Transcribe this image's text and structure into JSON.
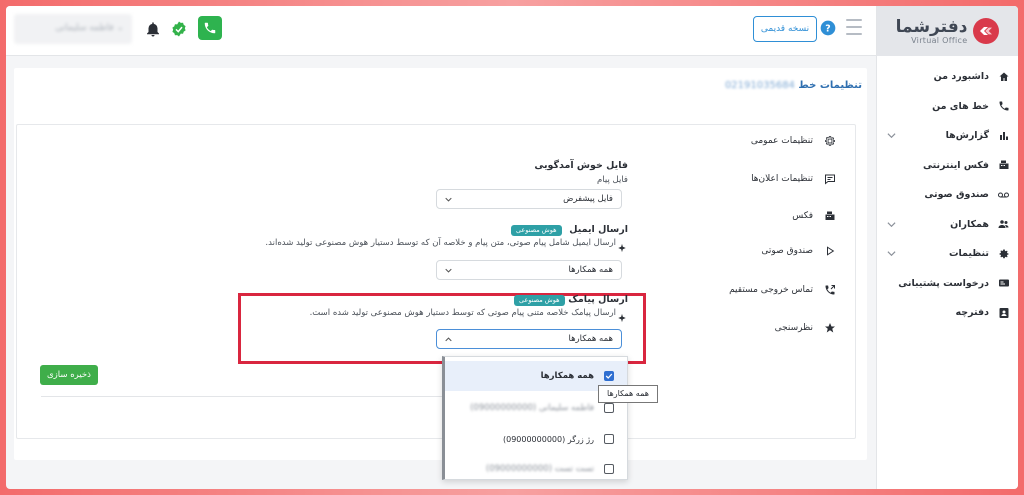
{
  "topbar": {
    "user_name": "فاطمه سلیمانی",
    "old_version_label": "نسخه قدیمی"
  },
  "logo": {
    "title": "دفترشما",
    "subtitle": "Virtual Office"
  },
  "sidebar": {
    "items": [
      {
        "label": "داشبورد من",
        "icon": "home-icon",
        "expandable": false
      },
      {
        "label": "خط های من",
        "icon": "phone-icon",
        "expandable": false
      },
      {
        "label": "گزارش‌ها",
        "icon": "chart-icon",
        "expandable": true
      },
      {
        "label": "فکس اینترنتی",
        "icon": "fax-icon",
        "expandable": false
      },
      {
        "label": "صندوق صوتی",
        "icon": "voicemail-icon",
        "expandable": false
      },
      {
        "label": "همکاران",
        "icon": "people-icon",
        "expandable": true
      },
      {
        "label": "تنظیمات",
        "icon": "gear-icon",
        "expandable": true
      },
      {
        "label": "درخواست پشتیبانی",
        "icon": "support-icon",
        "expandable": false
      },
      {
        "label": "دفترچه",
        "icon": "contacts-icon",
        "expandable": false
      }
    ]
  },
  "page": {
    "title": "تنظیمات خط",
    "line_number": "02191035684"
  },
  "settings_menu": [
    {
      "label": "تنظیمات عمومی",
      "icon": "gear-icon"
    },
    {
      "label": "تنظیمات اعلان‌ها",
      "icon": "chat-icon"
    },
    {
      "label": "فکس",
      "icon": "fax-icon"
    },
    {
      "label": "صندوق صوتی",
      "icon": "play-icon"
    },
    {
      "label": "تماس خروجی مستقیم",
      "icon": "phone-forward-icon"
    },
    {
      "label": "نظرسنجی",
      "icon": "star-icon"
    }
  ],
  "welcome": {
    "title": "فایل خوش آمدگویی",
    "subtitle": "فایل پیام",
    "select_value": "فایل پیشفرض"
  },
  "email": {
    "title": "ارسال ایمیل",
    "badge": "هوش مصنوعی",
    "description": "ارسال ایمیل شامل پیام صوتی، متن پیام و خلاصه آن که توسط دستیار هوش مصنوعی تولید شده‌اند.",
    "select_value": "همه همکارها"
  },
  "sms": {
    "title": "ارسال پیامک",
    "badge": "هوش مصنوعی",
    "description": "ارسال پیامک خلاصه متنی پیام صوتی که توسط دستیار هوش مصنوعی تولید شده است.",
    "select_value": "همه همکارها"
  },
  "dropdown": {
    "options": [
      {
        "label": "همه همکارها",
        "checked": true,
        "blurred": false
      },
      {
        "label": "فاطمه سلیمانی (09000000000)",
        "checked": false,
        "blurred": true
      },
      {
        "label": "رژ زرگر (09000000000)",
        "checked": false,
        "blurred": false
      },
      {
        "label": "تست تست (09000000000)",
        "checked": false,
        "blurred": true
      }
    ],
    "tooltip": "همه همکارها"
  },
  "save_label": "ذخیره سازی",
  "colors": {
    "brand_red": "#d93a4b",
    "accent_blue": "#2f8fd6",
    "ai_badge": "#2ea0a6",
    "save_green": "#3fae4a",
    "highlight": "#d9263f"
  }
}
